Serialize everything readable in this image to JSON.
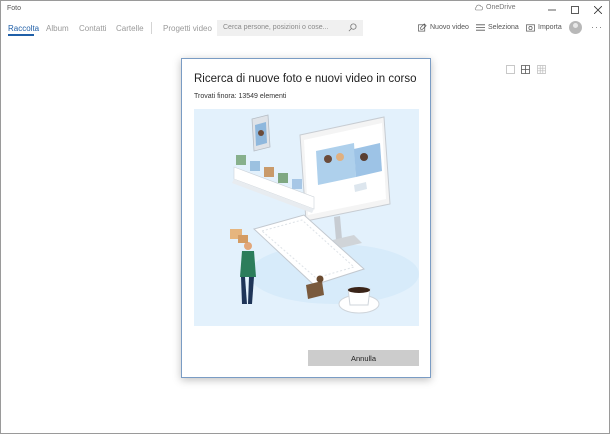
{
  "window": {
    "title": "Foto",
    "onedrive": "OneDrive"
  },
  "nav": {
    "tabs": [
      "Raccolta",
      "Album",
      "Contatti",
      "Cartelle"
    ],
    "projects": "Progetti video",
    "search_placeholder": "Cerca persone, posizioni o cose...",
    "new_video": "Nuovo video",
    "select": "Seleziona",
    "import": "Importa",
    "more": "···"
  },
  "dialog": {
    "title": "Ricerca di nuove foto e nuovi video in corso",
    "found": "Trovati finora: 13549 elementi",
    "cancel": "Annulla"
  },
  "colors": {
    "accent": "#1f5fa8",
    "illustration_bg": "#e3f1fc",
    "button": "#cccccc"
  }
}
